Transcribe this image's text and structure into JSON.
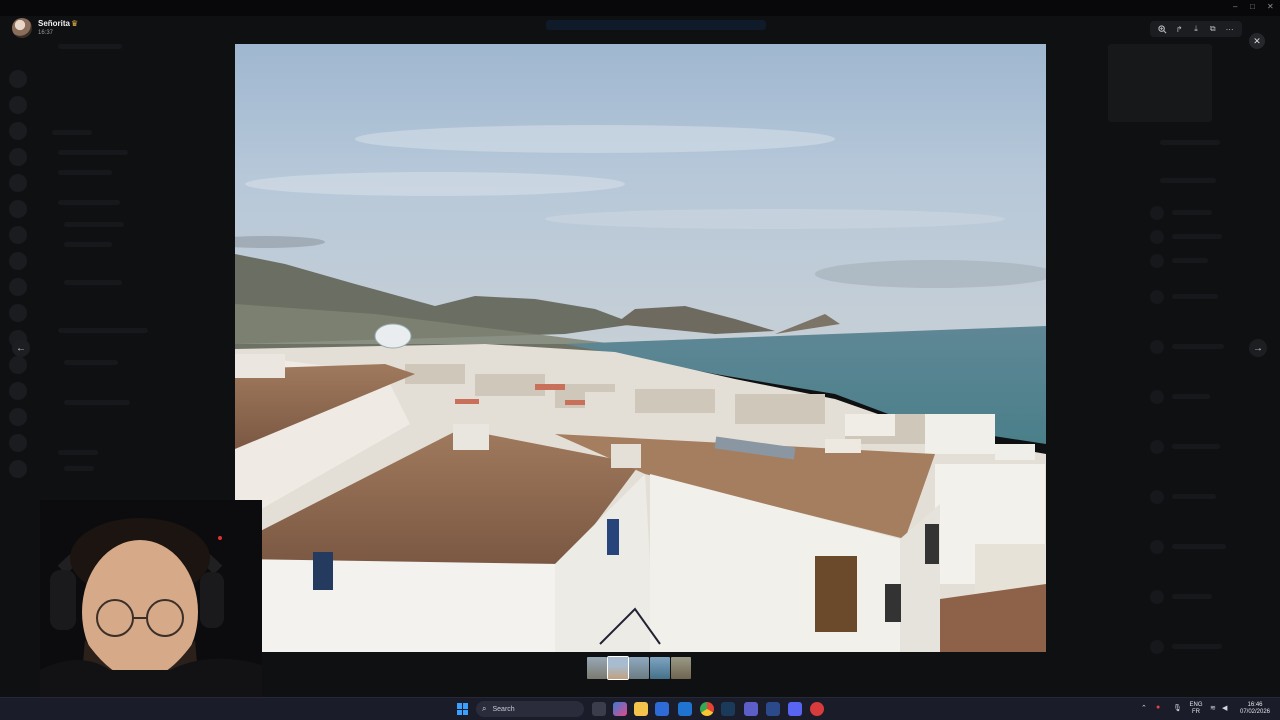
{
  "viewer": {
    "author": "Señorita",
    "time": "16:37"
  },
  "toolbar": {
    "zoom_icon": "zoom-in-icon",
    "forward_icon": "share-icon",
    "download_icon": "download-icon",
    "open_icon": "open-external-icon",
    "more_icon": "more-icon",
    "close_icon": "close-icon"
  },
  "gallery": {
    "thumbnail_count": 5,
    "active_index": 1
  },
  "taskbar": {
    "search_label": "Search",
    "language": "ENG",
    "layout": "FR",
    "time": "16:46",
    "date": "07/02/2026"
  },
  "colors": {
    "taskbar": "#1b1c2a",
    "windows_accent": "#3aa0ff",
    "crown": "#f1b94b"
  }
}
